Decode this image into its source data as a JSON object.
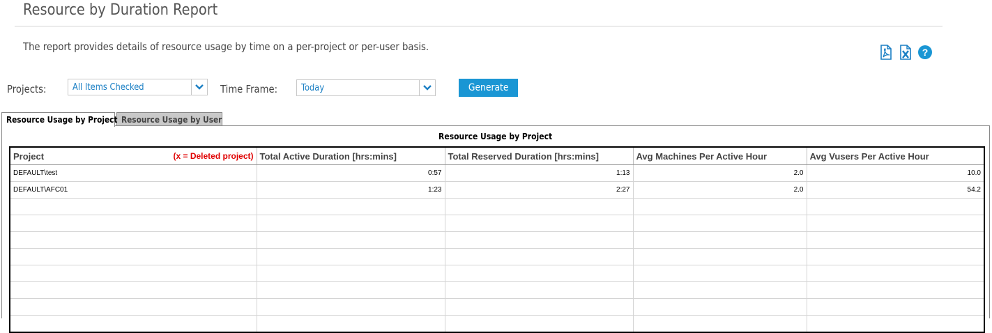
{
  "header": {
    "title": "Resource by Duration Report",
    "description": "The report provides details of resource usage by time on a per-project or per-user basis."
  },
  "toolbar": {
    "icons": [
      "export-pdf-icon",
      "export-excel-icon",
      "help-icon"
    ]
  },
  "filters": {
    "projects_label": "Projects:",
    "projects_value": "All Items Checked",
    "timeframe_label": "Time Frame:",
    "timeframe_value": "Today",
    "generate_label": "Generate"
  },
  "tabs": [
    {
      "label": "Resource Usage by Project",
      "active": true
    },
    {
      "label": "Resource Usage by User",
      "active": false
    }
  ],
  "report": {
    "title": "Resource Usage by Project",
    "columns": {
      "project": "Project",
      "deleted_note": "(x = Deleted project)",
      "active": "Total Active Duration [hrs:mins]",
      "reserved": "Total Reserved Duration [hrs:mins]",
      "machines": "Avg Machines Per Active Hour",
      "vusers": "Avg Vusers Per Active Hour"
    },
    "rows": [
      {
        "project": "DEFAULT\\test",
        "active": "0:57",
        "reserved": "1:13",
        "machines": "2.0",
        "vusers": "10.0"
      },
      {
        "project": "DEFAULT\\AFC01",
        "active": "1:23",
        "reserved": "2:27",
        "machines": "2.0",
        "vusers": "54.2"
      }
    ]
  },
  "colors": {
    "accent": "#1a96d4",
    "link": "#1a7fc4",
    "deleted": "#e00000"
  }
}
